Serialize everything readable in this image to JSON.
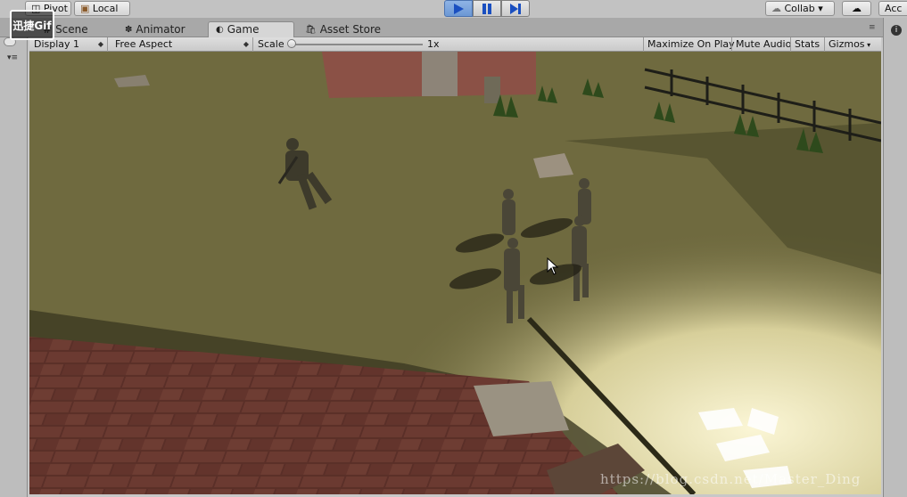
{
  "toolbar": {
    "pivot_label": "Pivot",
    "local_label": "Local",
    "collab_label": "Collab ▾",
    "account_label": "Acc"
  },
  "tabs": [
    {
      "label": "Scene",
      "icon": "scene-icon"
    },
    {
      "label": "Animator",
      "icon": "animator-icon"
    },
    {
      "label": "Game",
      "icon": "game-icon",
      "active": true
    },
    {
      "label": "Asset Store",
      "icon": "asset-store-icon"
    }
  ],
  "game_header": {
    "display": "Display 1",
    "aspect": "Free Aspect",
    "scale_label": "Scale",
    "scale_value": "1x",
    "buttons": [
      "Maximize On Play",
      "Mute Audio",
      "Stats",
      "Gizmos"
    ]
  },
  "watermark": {
    "gif_label": "迅捷Gif",
    "url_text": "https://blog.csdn.net/Master_Ding"
  },
  "colors": {
    "ground": "#6f6a3f",
    "play_active": "#6c98d4",
    "editor_bg": "#c2c2c2"
  }
}
